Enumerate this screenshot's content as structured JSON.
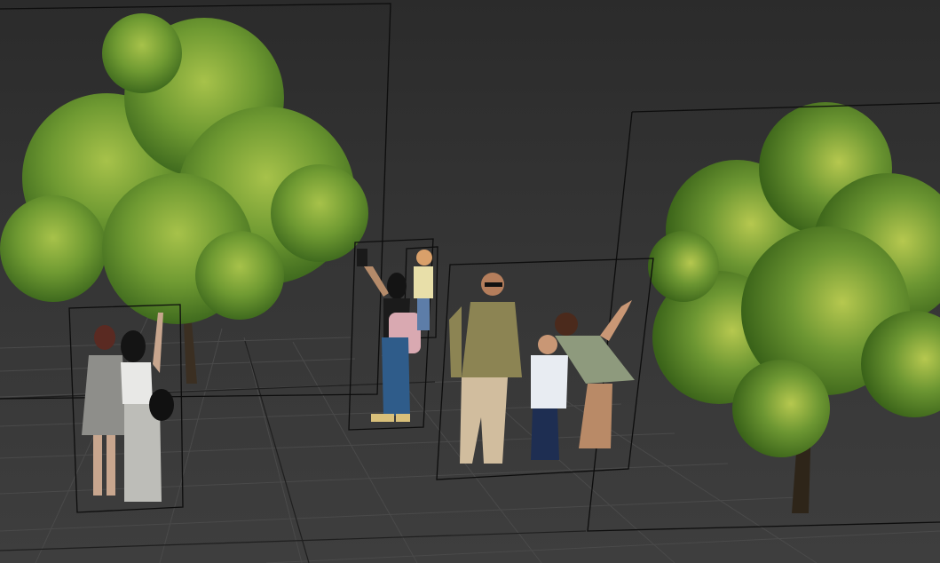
{
  "scene": {
    "type": "3d-viewport-perspective",
    "background_color": "#2e2e2e",
    "grid_color": "#4a4a4a",
    "frame_color": "#0d0d0d",
    "objects": [
      {
        "id": "tree-left",
        "kind": "tree-cutout",
        "color": "#6f9a32"
      },
      {
        "id": "tree-right",
        "kind": "tree-cutout",
        "color": "#6c9632"
      },
      {
        "id": "people-group-two-women",
        "kind": "people-cutout"
      },
      {
        "id": "woman-with-phone",
        "kind": "people-cutout"
      },
      {
        "id": "child-cutout",
        "kind": "people-cutout"
      },
      {
        "id": "family-group",
        "kind": "people-cutout"
      }
    ]
  }
}
